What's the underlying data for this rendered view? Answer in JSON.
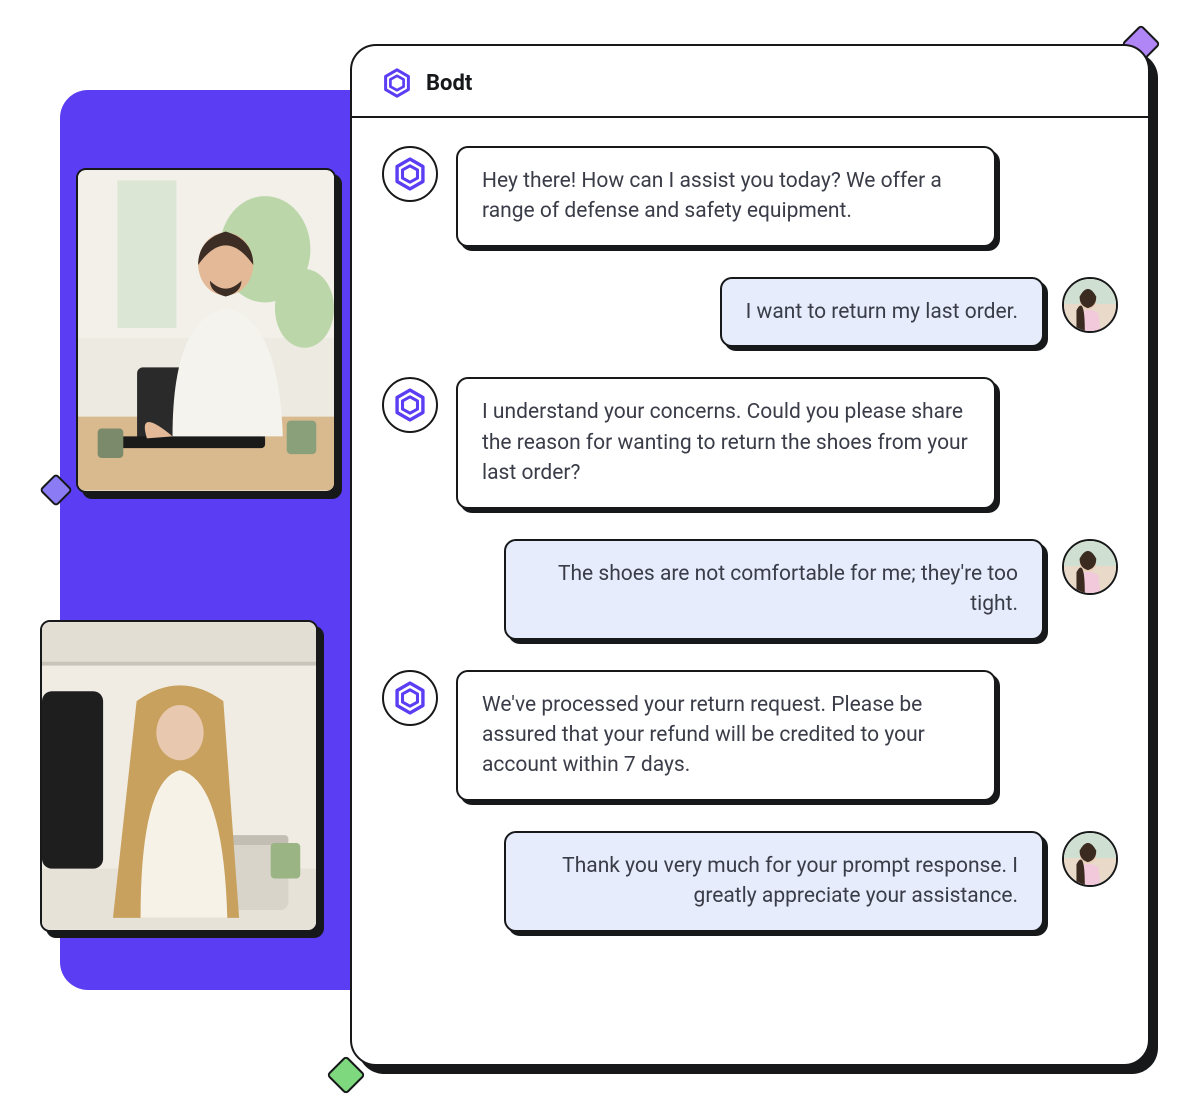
{
  "brand": {
    "name": "Bodt"
  },
  "decor": {
    "diamond_top_right": "purple-diamond",
    "diamond_bottom": "green-diamond",
    "diamond_mid": "purple-diamond"
  },
  "photos": {
    "photo1_alt": "Man typing on laptop at desk with plants",
    "photo2_alt": "Woman with long hair working on laptop in office"
  },
  "chat": {
    "messages": [
      {
        "role": "bot",
        "text": "Hey there! How can I assist you today? We offer a range of defense and safety equipment."
      },
      {
        "role": "user",
        "text": "I want to return my last order."
      },
      {
        "role": "bot",
        "text": "I understand your concerns. Could you please share the reason for wanting to return the shoes from your last order?"
      },
      {
        "role": "user",
        "text": "The shoes are not comfortable for me; they're too tight."
      },
      {
        "role": "bot",
        "text": "We've processed your return request. Please be assured that your refund will be credited to your account within 7 days."
      },
      {
        "role": "user",
        "text": "Thank you very much for your prompt response. I greatly appreciate your assistance."
      }
    ]
  }
}
